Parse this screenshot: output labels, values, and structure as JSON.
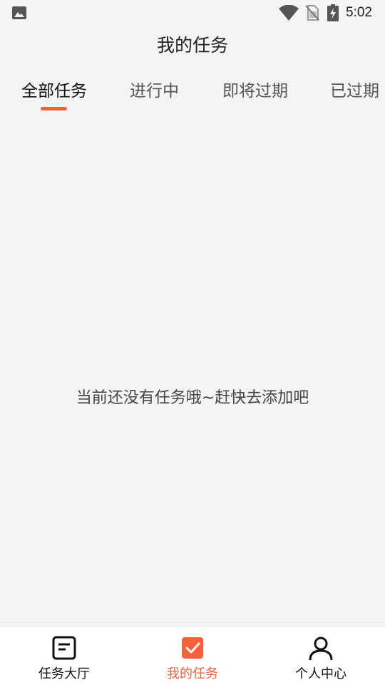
{
  "status_bar": {
    "time": "5:02",
    "icons": [
      "image-icon",
      "wifi-icon",
      "no-sim-icon",
      "battery-charging-icon"
    ]
  },
  "header": {
    "title": "我的任务"
  },
  "tabs": [
    {
      "label": "全部任务",
      "active": true
    },
    {
      "label": "进行中",
      "active": false
    },
    {
      "label": "即将过期",
      "active": false
    },
    {
      "label": "已过期",
      "active": false
    }
  ],
  "empty_state": {
    "message": "当前还没有任务哦~赶快去添加吧"
  },
  "bottom_nav": [
    {
      "label": "任务大厅",
      "icon": "task-hall-icon",
      "active": false
    },
    {
      "label": "我的任务",
      "icon": "my-tasks-check-icon",
      "active": true
    },
    {
      "label": "个人中心",
      "icon": "profile-icon",
      "active": false
    }
  ],
  "colors": {
    "accent": "#f4613b",
    "background": "#f4f4f4"
  }
}
